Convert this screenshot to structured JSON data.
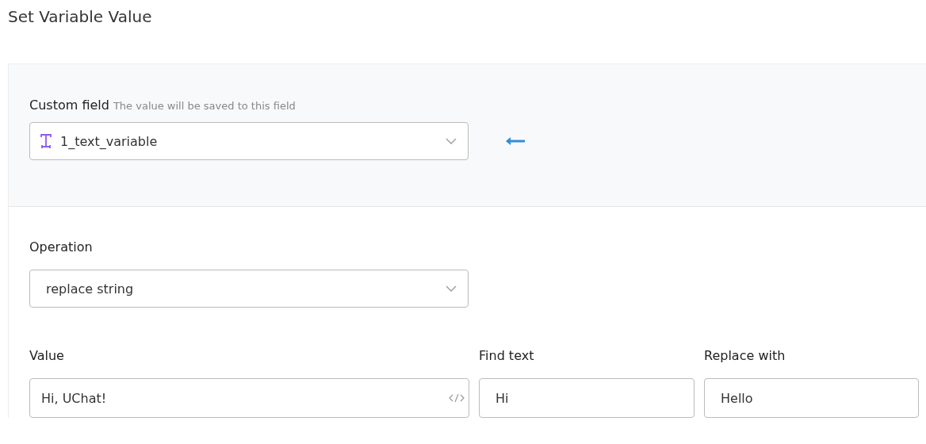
{
  "title": "Set Variable Value",
  "custom_field": {
    "label": "Custom field",
    "hint": "The value will be saved to this field",
    "value": "1_text_variable"
  },
  "operation": {
    "label": "Operation",
    "value": "replace string"
  },
  "inputs": [
    {
      "kind": "code",
      "label": "Value",
      "value": "Hi, UChat!"
    },
    {
      "kind": "plain",
      "label": "Find text",
      "value": "Hi"
    },
    {
      "kind": "plain",
      "label": "Replace with",
      "value": "Hello"
    }
  ]
}
